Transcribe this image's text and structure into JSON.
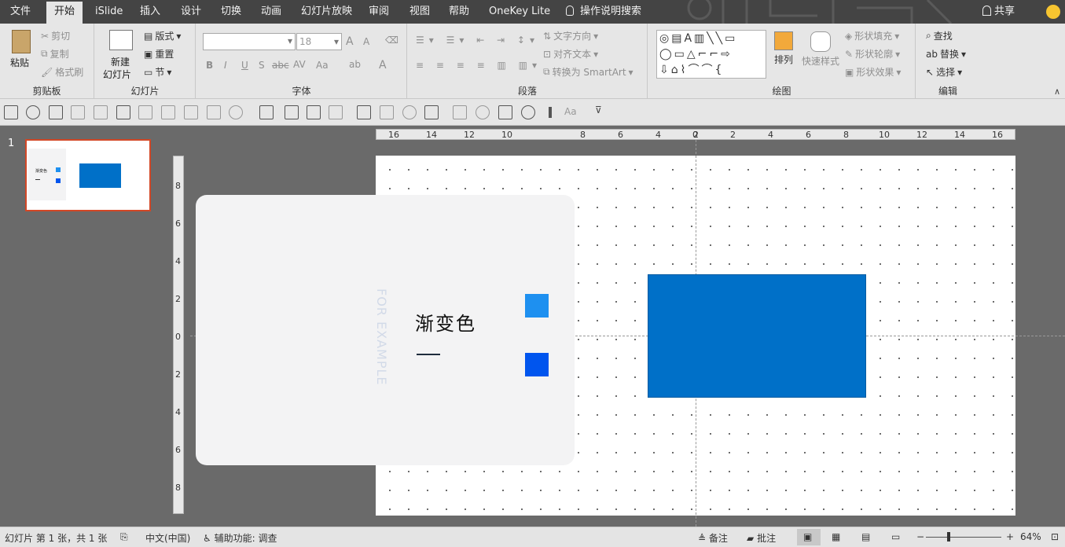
{
  "tabs": [
    "文件",
    "开始",
    "iSlide",
    "插入",
    "设计",
    "切换",
    "动画",
    "幻灯片放映",
    "审阅",
    "视图",
    "帮助",
    "OneKey Lite"
  ],
  "tell_me": "操作说明搜索",
  "share": "共享",
  "ribbon": {
    "clipboard": {
      "label": "剪贴板",
      "paste": "粘贴",
      "cut": "剪切",
      "copy": "复制",
      "format_painter": "格式刷"
    },
    "slides": {
      "label": "幻灯片",
      "new_slide_1": "新建",
      "new_slide_2": "幻灯片",
      "layout": "版式",
      "reset": "重置",
      "section": "节"
    },
    "font": {
      "label": "字体",
      "font_name": "",
      "font_size": "18",
      "grow": "A",
      "shrink": "A",
      "bold": "B",
      "italic": "I",
      "underline": "U",
      "shadow": "S",
      "strike": "abc",
      "spacing": "AV",
      "case": "Aa",
      "highlight": "ab",
      "color": "A"
    },
    "paragraph": {
      "label": "段落",
      "text_direction": "文字方向",
      "align_text": "对齐文本",
      "smartart": "转换为 SmartArt"
    },
    "drawing": {
      "label": "绘图",
      "arrange": "排列",
      "quick_styles": "快速样式",
      "fill": "形状填充",
      "outline": "形状轮廓",
      "effects": "形状效果"
    },
    "editing": {
      "label": "编辑",
      "find": "查找",
      "replace": "替换",
      "select": "选择"
    }
  },
  "qat_aa": "Aa",
  "thumbnail": {
    "number": "1",
    "title": "渐变色"
  },
  "ruler_h": [
    "16",
    "14",
    "12",
    "10",
    "8",
    "6",
    "4",
    "2",
    "0",
    "2",
    "4",
    "6",
    "8",
    "10",
    "12",
    "14",
    "16"
  ],
  "ruler_v": [
    "8",
    "6",
    "4",
    "2",
    "0",
    "2",
    "4",
    "6",
    "8"
  ],
  "slide": {
    "title": "渐变色",
    "vertical_text": "FOR EXAMPLE",
    "colors": {
      "small_square_1": "#1E90F0",
      "small_square_2": "#0055EE",
      "rect": "#0070C8",
      "card": "#F3F3F4"
    }
  },
  "status": {
    "slide_info": "幻灯片 第 1 张，共 1 张",
    "language": "中文(中国)",
    "accessibility": "辅助功能: 调查",
    "notes": "备注",
    "comments": "批注",
    "zoom": "64%"
  }
}
